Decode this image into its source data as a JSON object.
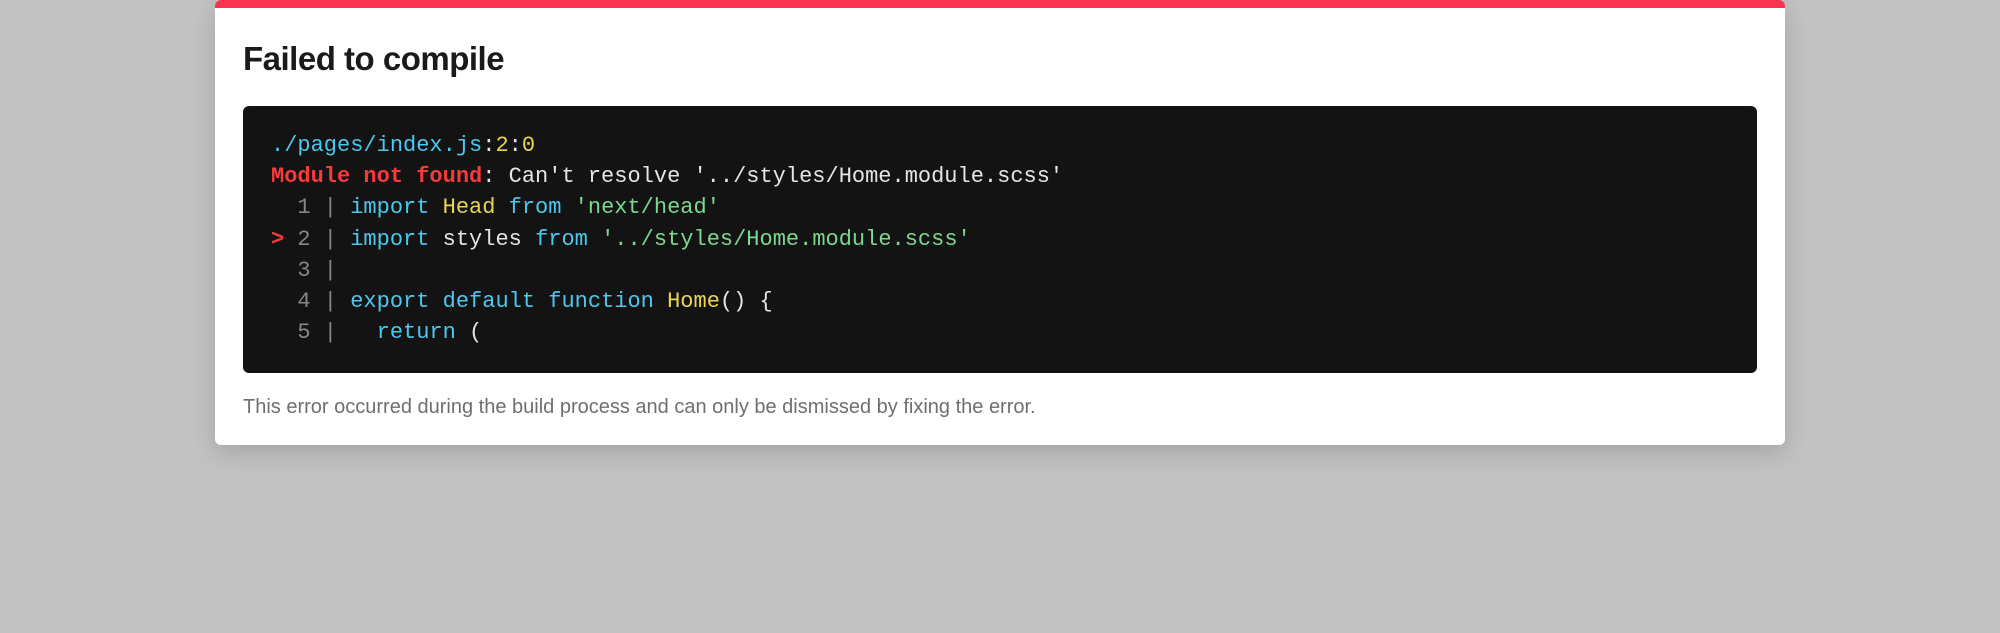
{
  "title": "Failed to compile",
  "location": {
    "file": "./pages/index.js",
    "line": "2",
    "col": "0"
  },
  "error": {
    "label": "Module not found",
    "message": ": Can't resolve '../styles/Home.module.scss'"
  },
  "code": {
    "l1": {
      "gutter": "  1 | ",
      "kw": "import",
      "id": "Head",
      "from": "from",
      "str": "'next/head'"
    },
    "l2": {
      "caret": ">",
      "gutter": " 2 | ",
      "kw": "import",
      "id": "styles",
      "from": "from",
      "str": "'../styles/Home.module.scss'"
    },
    "l3": {
      "gutter": "  3 | "
    },
    "l4": {
      "gutter": "  4 | ",
      "kw1": "export",
      "kw2": "default",
      "kw3": "function",
      "id": "Home",
      "tail": "() {"
    },
    "l5": {
      "gutter": "  5 |   ",
      "kw": "return",
      "tail": " ("
    }
  },
  "footer": "This error occurred during the build process and can only be dismissed by fixing the error."
}
